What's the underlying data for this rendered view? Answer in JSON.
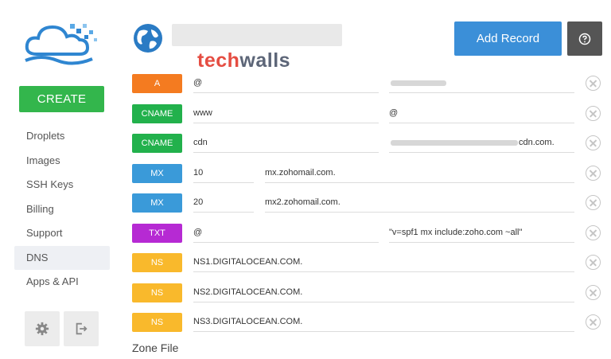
{
  "sidebar": {
    "create_label": "CREATE",
    "nav": [
      {
        "label": "Droplets"
      },
      {
        "label": "Images"
      },
      {
        "label": "SSH Keys"
      },
      {
        "label": "Billing"
      },
      {
        "label": "Support"
      },
      {
        "label": "DNS",
        "active": true
      },
      {
        "label": "Apps & API"
      }
    ],
    "footer_icons": [
      "gear-icon",
      "logout-icon"
    ]
  },
  "header": {
    "add_record_label": "Add Record",
    "help_icon": "question-circle-icon",
    "globe_icon": "globe-icon"
  },
  "watermark": {
    "part1": "tech",
    "part2": "walls"
  },
  "records": [
    {
      "type": "A",
      "color": "#f47b20",
      "host": "@",
      "value": ""
    },
    {
      "type": "CNAME",
      "color": "#22b14c",
      "host": "www",
      "value": "@"
    },
    {
      "type": "CNAME",
      "color": "#22b14c",
      "host": "cdn",
      "value": "cdn.com."
    },
    {
      "type": "MX",
      "color": "#3a9ad9",
      "host": "",
      "priority": "10",
      "value": "mx.zohomail.com."
    },
    {
      "type": "MX",
      "color": "#3a9ad9",
      "host": "",
      "priority": "20",
      "value": "mx2.zohomail.com."
    },
    {
      "type": "TXT",
      "color": "#b62ad3",
      "host": "@",
      "value": "\"v=spf1 mx include:zoho.com ~all\""
    },
    {
      "type": "NS",
      "color": "#f9b92c",
      "host": "NS1.DIGITALOCEAN.COM.",
      "value": ""
    },
    {
      "type": "NS",
      "color": "#f9b92c",
      "host": "NS2.DIGITALOCEAN.COM.",
      "value": ""
    },
    {
      "type": "NS",
      "color": "#f9b92c",
      "host": "NS3.DIGITALOCEAN.COM.",
      "value": ""
    }
  ],
  "zone_file_label": "Zone File"
}
